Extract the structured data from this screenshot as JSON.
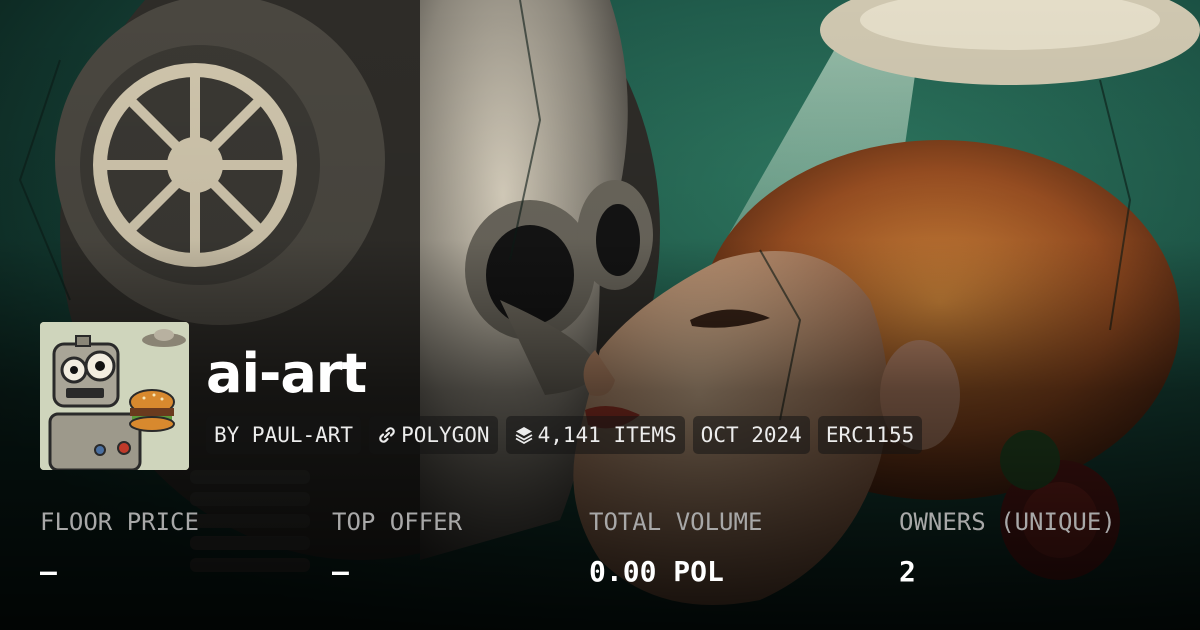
{
  "collection": {
    "title": "ai-art",
    "avatar": {
      "icon": "robot-eating-burger-icon"
    }
  },
  "chips": [
    {
      "label": "BY PAUL-ART"
    },
    {
      "label": "POLYGON",
      "icon": "polygon-link-icon"
    },
    {
      "label": "4,141 ITEMS",
      "icon": "layers-icon"
    },
    {
      "label": "OCT 2024"
    },
    {
      "label": "ERC1155"
    }
  ],
  "stats": [
    {
      "label": "FLOOR PRICE",
      "value": "—"
    },
    {
      "label": "TOP OFFER",
      "value": "—"
    },
    {
      "label": "TOTAL VOLUME",
      "value": "0.00 POL"
    },
    {
      "label": "OWNERS (UNIQUE)",
      "value": "2"
    }
  ],
  "colors": {
    "background_teal": "#1d5a4a",
    "chip_background": "#141414",
    "stat_label": "#a8a8a8",
    "text": "#ffffff"
  }
}
